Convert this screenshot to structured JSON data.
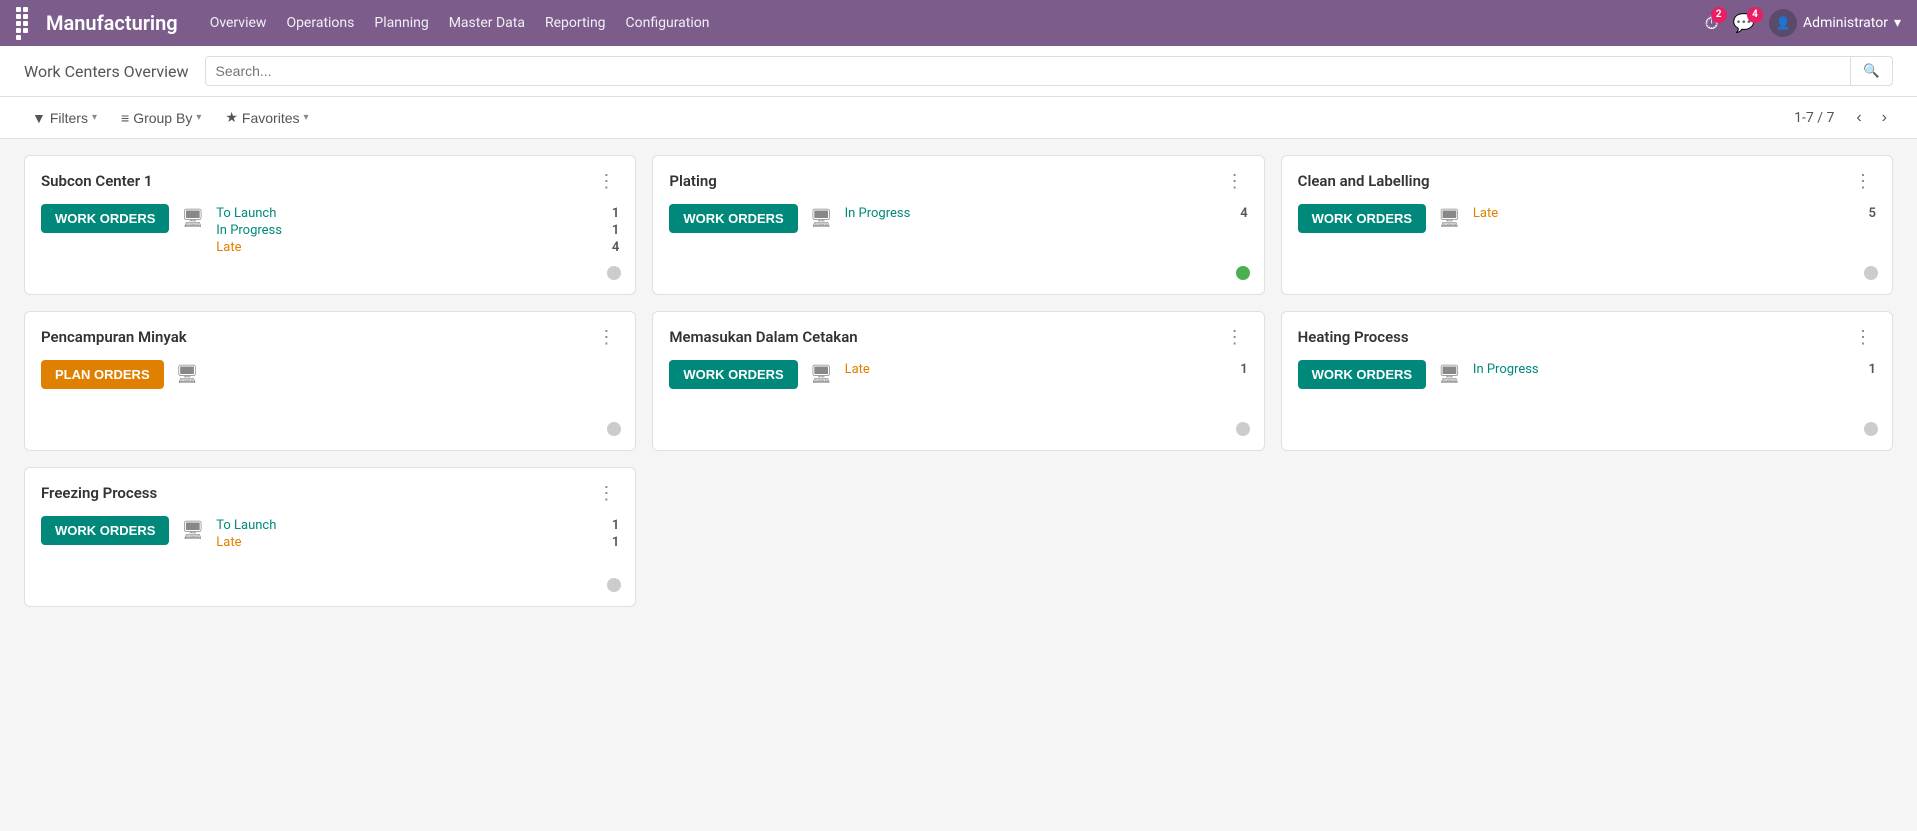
{
  "topnav": {
    "app_title": "Manufacturing",
    "menu_items": [
      "Overview",
      "Operations",
      "Planning",
      "Master Data",
      "Reporting",
      "Configuration"
    ],
    "badge_clock": "2",
    "badge_chat": "4",
    "user_label": "Administrator",
    "user_arrow": "▾"
  },
  "page": {
    "title": "Work Centers Overview"
  },
  "search": {
    "placeholder": "Search..."
  },
  "filters": {
    "filters_label": "Filters",
    "group_by_label": "Group By",
    "favorites_label": "Favorites",
    "pagination": "1-7 / 7"
  },
  "cards": [
    {
      "id": "subcon-center-1",
      "title": "Subcon Center 1",
      "button_type": "work_orders",
      "button_label": "WORK ORDERS",
      "stats": [
        {
          "label": "To Launch",
          "value": "1",
          "type": "to-launch"
        },
        {
          "label": "In Progress",
          "value": "1",
          "type": "in-progress"
        },
        {
          "label": "Late",
          "value": "4",
          "type": "late"
        }
      ],
      "status": "grey"
    },
    {
      "id": "plating",
      "title": "Plating",
      "button_type": "work_orders",
      "button_label": "WORK ORDERS",
      "stats": [
        {
          "label": "In Progress",
          "value": "4",
          "type": "in-progress"
        }
      ],
      "status": "green"
    },
    {
      "id": "clean-and-labelling",
      "title": "Clean and Labelling",
      "button_type": "work_orders",
      "button_label": "WORK ORDERS",
      "stats": [
        {
          "label": "Late",
          "value": "5",
          "type": "late"
        }
      ],
      "status": "grey"
    },
    {
      "id": "pencampuran-minyak",
      "title": "Pencampuran Minyak",
      "button_type": "plan_orders",
      "button_label": "PLAN ORDERS",
      "stats": [],
      "status": "grey"
    },
    {
      "id": "memasukan-dalam-cetakan",
      "title": "Memasukan Dalam Cetakan",
      "button_type": "work_orders",
      "button_label": "WORK ORDERS",
      "stats": [
        {
          "label": "Late",
          "value": "1",
          "type": "late"
        }
      ],
      "status": "grey"
    },
    {
      "id": "heating-process",
      "title": "Heating Process",
      "button_type": "work_orders",
      "button_label": "WORK ORDERS",
      "stats": [
        {
          "label": "In Progress",
          "value": "1",
          "type": "in-progress"
        }
      ],
      "status": "grey"
    },
    {
      "id": "freezing-process",
      "title": "Freezing Process",
      "button_type": "work_orders",
      "button_label": "WORK ORDERS",
      "stats": [
        {
          "label": "To Launch",
          "value": "1",
          "type": "to-launch"
        },
        {
          "label": "Late",
          "value": "1",
          "type": "late"
        }
      ],
      "status": "grey"
    }
  ]
}
